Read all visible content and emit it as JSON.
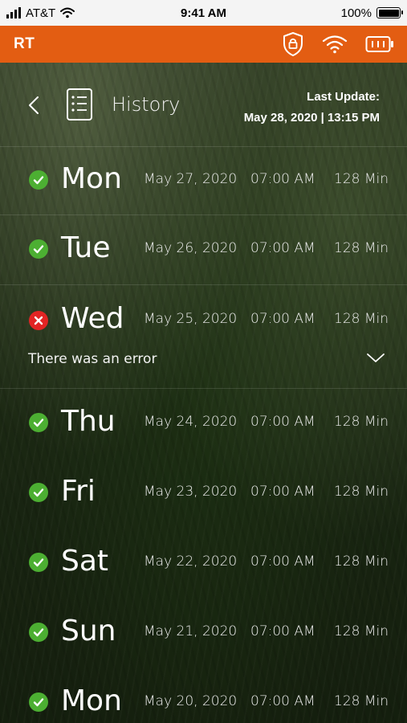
{
  "status_bar": {
    "carrier": "AT&T",
    "time": "9:41 AM",
    "battery": "100%"
  },
  "app_bar": {
    "title": "RT",
    "icons": [
      "lock-shield-icon",
      "wifi-icon",
      "battery-icon"
    ]
  },
  "header": {
    "title": "History",
    "last_update_label": "Last Update:",
    "last_update_value": "May 28, 2020 | 13:15 PM"
  },
  "history": [
    {
      "day": "Mon",
      "date": "May 27, 2020",
      "time": "07:00 AM",
      "duration": "128 Min",
      "status": "ok"
    },
    {
      "day": "Tue",
      "date": "May 26, 2020",
      "time": "07:00 AM",
      "duration": "128 Min",
      "status": "ok"
    },
    {
      "day": "Wed",
      "date": "May 25, 2020",
      "time": "07:00 AM",
      "duration": "128 Min",
      "status": "error",
      "message": "There was an error"
    },
    {
      "day": "Thu",
      "date": "May 24, 2020",
      "time": "07:00 AM",
      "duration": "128 Min",
      "status": "ok"
    },
    {
      "day": "Fri",
      "date": "May 23, 2020",
      "time": "07:00 AM",
      "duration": "128 Min",
      "status": "ok"
    },
    {
      "day": "Sat",
      "date": "May 22, 2020",
      "time": "07:00 AM",
      "duration": "128 Min",
      "status": "ok"
    },
    {
      "day": "Sun",
      "date": "May 21, 2020",
      "time": "07:00 AM",
      "duration": "128 Min",
      "status": "ok"
    },
    {
      "day": "Mon",
      "date": "May 20, 2020",
      "time": "07:00 AM",
      "duration": "128 Min",
      "status": "ok"
    }
  ],
  "colors": {
    "accent": "#e35d12",
    "ok": "#4caf32",
    "error": "#e22424"
  }
}
